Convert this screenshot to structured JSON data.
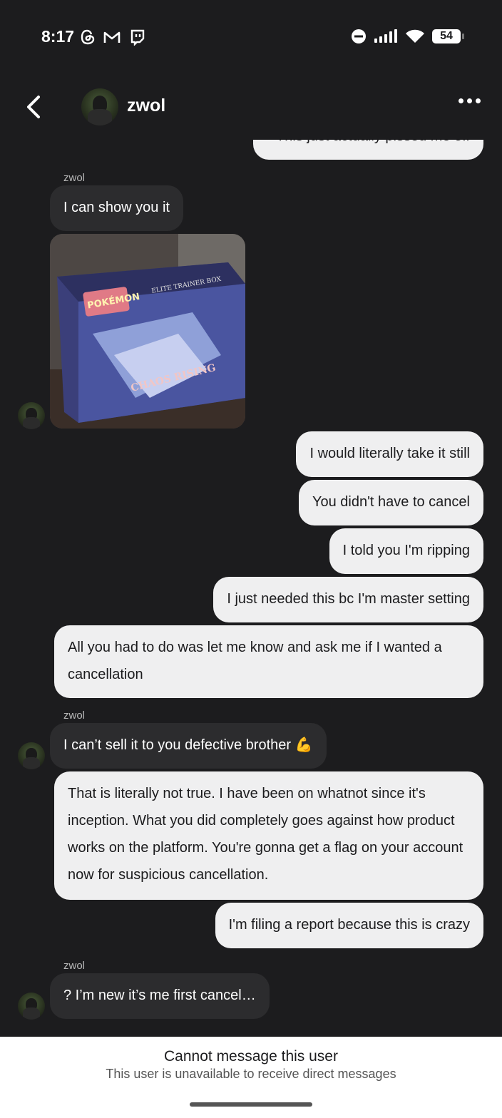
{
  "status_bar": {
    "time": "8:17",
    "battery": "54"
  },
  "header": {
    "contact_name": "zwol"
  },
  "messages": {
    "m0": "This just actually pissed me off",
    "s1": "zwol",
    "m1": "I can show you it",
    "m2": "I would literally take it still",
    "m3": "You didn't have to cancel",
    "m4": "I told you I'm ripping",
    "m5": "I just needed this bc I'm master setting",
    "m6": "All you had to do was let me know and ask me if I wanted a cancellation",
    "s2": "zwol",
    "m7": "I can’t sell it to you defective brother 💪",
    "m8": "That is literally not true. I have been on whatnot since it's inception. What you did completely goes against how product works on the platform. You're gonna get a flag on your account now for suspicious cancellation.",
    "m9": "I'm filing a report because this is crazy",
    "s3": "zwol",
    "m10": "? I’m new it’s me first cancel…"
  },
  "photo": {
    "box_label": "ELITE TRAINER BOX",
    "brand": "POKÉMON",
    "set_name": "CHAOS RISING"
  },
  "footer": {
    "title": "Cannot message this user",
    "subtitle": "This user is unavailable to receive direct messages"
  }
}
